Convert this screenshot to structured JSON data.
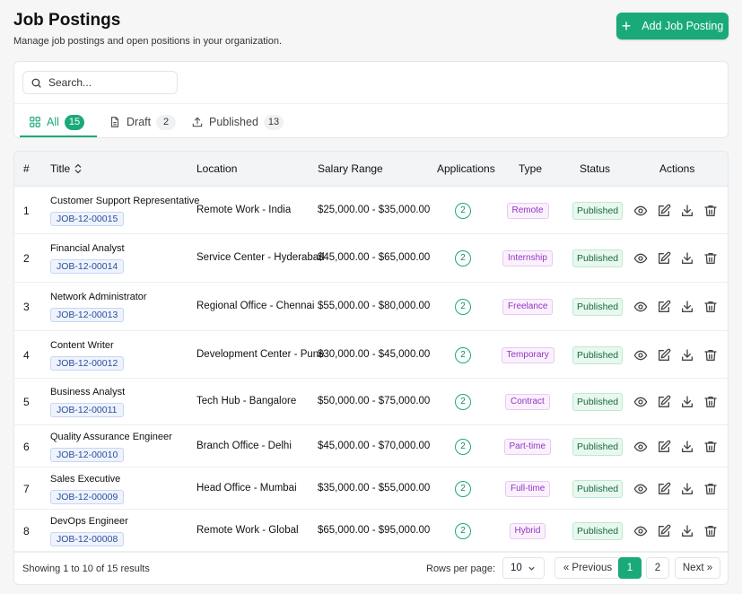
{
  "header": {
    "title": "Job Postings",
    "subtitle": "Manage job postings and open positions in your organization.",
    "add_button": "Add Job Posting"
  },
  "search": {
    "placeholder": "Search..."
  },
  "tabs": [
    {
      "label": "All",
      "count": "15",
      "icon": "grid-icon",
      "active": true
    },
    {
      "label": "Draft",
      "count": "2",
      "icon": "document-icon",
      "active": false
    },
    {
      "label": "Published",
      "count": "13",
      "icon": "upload-icon",
      "active": false
    }
  ],
  "table": {
    "columns": {
      "index": "#",
      "title": "Title",
      "location": "Location",
      "salary": "Salary Range",
      "applications": "Applications",
      "type": "Type",
      "status": "Status",
      "actions": "Actions"
    },
    "rows": [
      {
        "index": "1",
        "title": "Customer Support Representative",
        "job_id": "JOB-12-00015",
        "location": "Remote Work - India",
        "salary": "$25,000.00 - $35,000.00",
        "applications": "2",
        "type": "Remote",
        "status": "Published"
      },
      {
        "index": "2",
        "title": "Financial Analyst",
        "job_id": "JOB-12-00014",
        "location": "Service Center - Hyderabad",
        "salary": "$45,000.00 - $65,000.00",
        "applications": "2",
        "type": "Internship",
        "status": "Published"
      },
      {
        "index": "3",
        "title": "Network Administrator",
        "job_id": "JOB-12-00013",
        "location": "Regional Office - Chennai",
        "salary": "$55,000.00 - $80,000.00",
        "applications": "2",
        "type": "Freelance",
        "status": "Published"
      },
      {
        "index": "4",
        "title": "Content Writer",
        "job_id": "JOB-12-00012",
        "location": "Development Center - Pune",
        "salary": "$30,000.00 - $45,000.00",
        "applications": "2",
        "type": "Temporary",
        "status": "Published"
      },
      {
        "index": "5",
        "title": "Business Analyst",
        "job_id": "JOB-12-00011",
        "location": "Tech Hub - Bangalore",
        "salary": "$50,000.00 - $75,000.00",
        "applications": "2",
        "type": "Contract",
        "status": "Published"
      },
      {
        "index": "6",
        "title": "Quality Assurance Engineer",
        "job_id": "JOB-12-00010",
        "location": "Branch Office - Delhi",
        "salary": "$45,000.00 - $70,000.00",
        "applications": "2",
        "type": "Part-time",
        "status": "Published"
      },
      {
        "index": "7",
        "title": "Sales Executive",
        "job_id": "JOB-12-00009",
        "location": "Head Office - Mumbai",
        "salary": "$35,000.00 - $55,000.00",
        "applications": "2",
        "type": "Full-time",
        "status": "Published"
      },
      {
        "index": "8",
        "title": "DevOps Engineer",
        "job_id": "JOB-12-00008",
        "location": "Remote Work - Global",
        "salary": "$65,000.00 - $95,000.00",
        "applications": "2",
        "type": "Hybrid",
        "status": "Published"
      }
    ],
    "action_icons": [
      "eye-icon",
      "edit-icon",
      "download-icon",
      "trash-icon"
    ]
  },
  "footer": {
    "showing": "Showing 1 to 10 of 15 results",
    "rows_per_page_label": "Rows per page:",
    "rows_per_page_value": "10",
    "prev": "« Previous",
    "pages": [
      "1",
      "2"
    ],
    "current_page": "1",
    "next": "Next »"
  },
  "colors": {
    "accent": "#1aaa7a",
    "job_id_bg": "#eef3fd",
    "type_badge": "#9335c2",
    "status_badge": "#17693f"
  }
}
